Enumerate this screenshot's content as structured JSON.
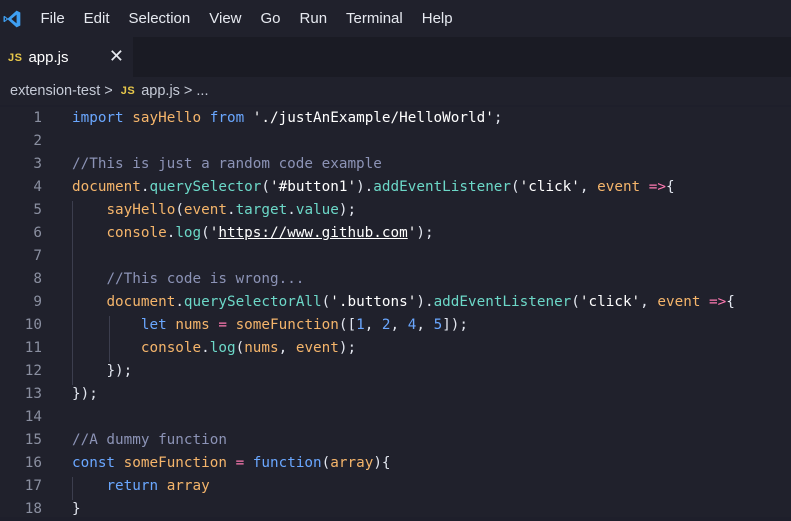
{
  "menubar": {
    "items": [
      "File",
      "Edit",
      "Selection",
      "View",
      "Go",
      "Run",
      "Terminal",
      "Help"
    ]
  },
  "tab": {
    "badge": "JS",
    "label": "app.js",
    "close": "✕"
  },
  "breadcrumb": {
    "folder": "extension-test",
    "sep": ">",
    "badge": "JS",
    "file": "app.js",
    "ellipsis": "..."
  },
  "editor": {
    "line_numbers": [
      "1",
      "2",
      "3",
      "4",
      "5",
      "6",
      "7",
      "8",
      "9",
      "10",
      "11",
      "12",
      "13",
      "14",
      "15",
      "16",
      "17",
      "18"
    ],
    "lines": [
      [
        [
          "kw",
          "import"
        ],
        [
          "pn",
          " "
        ],
        [
          "fn",
          "sayHello"
        ],
        [
          "pn",
          " "
        ],
        [
          "kw",
          "from"
        ],
        [
          "pn",
          " "
        ],
        [
          "str",
          "'./justAnExample/HelloWorld'"
        ],
        [
          "pn",
          ";"
        ]
      ],
      [],
      [
        [
          "cmt",
          "//This is just a random code example"
        ]
      ],
      [
        [
          "fn",
          "document"
        ],
        [
          "pn",
          "."
        ],
        [
          "prop",
          "querySelector"
        ],
        [
          "pn",
          "("
        ],
        [
          "str",
          "'#button1'"
        ],
        [
          "pn",
          ")."
        ],
        [
          "prop",
          "addEventListener"
        ],
        [
          "pn",
          "("
        ],
        [
          "str",
          "'click'"
        ],
        [
          "pn",
          ", "
        ],
        [
          "var",
          "event"
        ],
        [
          "pn",
          " "
        ],
        [
          "op",
          "=>"
        ],
        [
          "pn",
          "{"
        ]
      ],
      [
        [
          "pn",
          "    "
        ],
        [
          "fn",
          "sayHello"
        ],
        [
          "pn",
          "("
        ],
        [
          "var",
          "event"
        ],
        [
          "pn",
          "."
        ],
        [
          "prop",
          "target"
        ],
        [
          "pn",
          "."
        ],
        [
          "prop",
          "value"
        ],
        [
          "pn",
          ");"
        ]
      ],
      [
        [
          "pn",
          "    "
        ],
        [
          "fn",
          "console"
        ],
        [
          "pn",
          "."
        ],
        [
          "prop",
          "log"
        ],
        [
          "pn",
          "("
        ],
        [
          "str",
          "'"
        ],
        [
          "url",
          "https://www.github.com"
        ],
        [
          "str",
          "'"
        ],
        [
          "pn",
          ");"
        ]
      ],
      [],
      [
        [
          "pn",
          "    "
        ],
        [
          "cmt",
          "//This code is wrong..."
        ]
      ],
      [
        [
          "pn",
          "    "
        ],
        [
          "fn",
          "document"
        ],
        [
          "pn",
          "."
        ],
        [
          "prop",
          "querySelectorAll"
        ],
        [
          "pn",
          "("
        ],
        [
          "str",
          "'.buttons'"
        ],
        [
          "pn",
          ")."
        ],
        [
          "prop",
          "addEventListener"
        ],
        [
          "pn",
          "("
        ],
        [
          "str",
          "'click'"
        ],
        [
          "pn",
          ", "
        ],
        [
          "var",
          "event"
        ],
        [
          "pn",
          " "
        ],
        [
          "op",
          "=>"
        ],
        [
          "pn",
          "{"
        ]
      ],
      [
        [
          "pn",
          "        "
        ],
        [
          "kw",
          "let"
        ],
        [
          "pn",
          " "
        ],
        [
          "var",
          "nums"
        ],
        [
          "pn",
          " "
        ],
        [
          "op",
          "="
        ],
        [
          "pn",
          " "
        ],
        [
          "fn",
          "someFunction"
        ],
        [
          "pn",
          "(["
        ],
        [
          "num",
          "1"
        ],
        [
          "pn",
          ", "
        ],
        [
          "num",
          "2"
        ],
        [
          "pn",
          ", "
        ],
        [
          "num",
          "4"
        ],
        [
          "pn",
          ", "
        ],
        [
          "num",
          "5"
        ],
        [
          "pn",
          "]);"
        ]
      ],
      [
        [
          "pn",
          "        "
        ],
        [
          "fn",
          "console"
        ],
        [
          "pn",
          "."
        ],
        [
          "prop",
          "log"
        ],
        [
          "pn",
          "("
        ],
        [
          "var",
          "nums"
        ],
        [
          "pn",
          ", "
        ],
        [
          "var",
          "event"
        ],
        [
          "pn",
          ");"
        ]
      ],
      [
        [
          "pn",
          "    "
        ],
        [
          "pn",
          "});"
        ]
      ],
      [
        [
          "pn",
          "});"
        ]
      ],
      [],
      [
        [
          "cmt",
          "//A dummy function"
        ]
      ],
      [
        [
          "kw",
          "const"
        ],
        [
          "pn",
          " "
        ],
        [
          "fn",
          "someFunction"
        ],
        [
          "pn",
          " "
        ],
        [
          "op",
          "="
        ],
        [
          "pn",
          " "
        ],
        [
          "kw",
          "function"
        ],
        [
          "pn",
          "("
        ],
        [
          "var",
          "array"
        ],
        [
          "pn",
          "){"
        ]
      ],
      [
        [
          "pn",
          "    "
        ],
        [
          "kw",
          "return"
        ],
        [
          "pn",
          " "
        ],
        [
          "var",
          "array"
        ]
      ],
      [
        [
          "pn",
          "}"
        ]
      ]
    ]
  },
  "colors": {
    "background": "#20212c",
    "keyword": "#6aa7ff",
    "function": "#f5b56b",
    "property": "#6cd8c8",
    "string": "#ffffff",
    "comment": "#8c93b6",
    "operator": "#ff7ab2",
    "js_badge": "#e8c84a",
    "logo": "#3e9ff2"
  },
  "icons": {
    "logo": "vscode-logo-icon",
    "tab_badge": "js-file-icon",
    "close": "close-icon",
    "chevron": "chevron-right-icon"
  }
}
